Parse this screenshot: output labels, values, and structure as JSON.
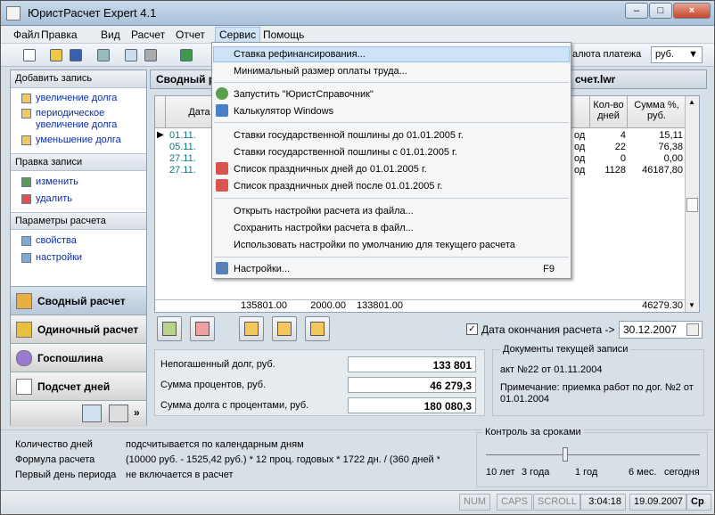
{
  "window": {
    "title": "ЮристРасчет Expert 4.1"
  },
  "menubar": {
    "items": [
      "Файл",
      "Правка",
      "Вид",
      "Расчет",
      "Отчет",
      "Сервис",
      "Помощь"
    ]
  },
  "toolbar": {
    "currency_label": "алюта платежа",
    "currency_value": "руб."
  },
  "sidebar": {
    "add_header": "Добавить запись",
    "add_items": [
      "увеличение долга",
      "периодическое увеличение долга",
      "уменьшение долга"
    ],
    "edit_header": "Правка записи",
    "edit_items": [
      "изменить",
      "удалить"
    ],
    "params_header": "Параметры расчета",
    "params_items": [
      "свойства",
      "настройки"
    ],
    "nav": [
      "Сводный расчет",
      "Одиночный расчет",
      "Госпошлина",
      "Подсчет дней"
    ]
  },
  "panel": {
    "title_left": "Сводный р",
    "title_right": "счет.lwr"
  },
  "grid": {
    "headers": {
      "date": "Дата",
      "days": "Кол-во дней",
      "sum": "Сумма %, руб."
    },
    "rows": [
      {
        "date": "01.11.",
        "code": "од",
        "days": "4",
        "sum": "15,11"
      },
      {
        "date": "05.11.",
        "code": "од",
        "days": "22",
        "sum": "76,38"
      },
      {
        "date": "27.11.",
        "code": "од",
        "days": "0",
        "sum": "0,00"
      },
      {
        "date": "27.11.",
        "code": "од",
        "days": "1128",
        "sum": "46187,80"
      }
    ],
    "totals": [
      "135801.00",
      "2000.00",
      "133801.00",
      "46279.30"
    ]
  },
  "end_date": {
    "label": "Дата окончания расчета ->",
    "value": "30.12.2007"
  },
  "summary": {
    "rows": [
      {
        "label": "Непогашенный долг, руб.",
        "value": "133 801"
      },
      {
        "label": "Сумма процентов, руб.",
        "value": "46 279,3"
      },
      {
        "label": "Сумма долга с процентами, руб.",
        "value": "180 080,3"
      }
    ]
  },
  "docs": {
    "title": "Документы текущей записи",
    "line1": "акт №22 от 01.11.2004",
    "line2": "Примечание: приемка работ по дог. №2 от 01.01.2004"
  },
  "bottom": {
    "rows": [
      {
        "label": "Количество дней",
        "value": "подсчитывается по календарным дням"
      },
      {
        "label": "Формула расчета",
        "value": "(10000 руб. - 1525,42 руб.) * 12 проц. годовых * 1722 дн. / (360 дней * 1"
      },
      {
        "label": "Первый день периода",
        "value": "не включается в расчет"
      }
    ]
  },
  "control": {
    "title": "Контроль за сроками",
    "ticks": [
      "10 лет",
      "3 года",
      "1 год",
      "6 мес.",
      "сегодня"
    ]
  },
  "status": {
    "num": "NUM",
    "caps": "CAPS",
    "scroll": "SCROLL",
    "time": "3:04:18",
    "date": "19.09.2007",
    "extra": "Ср"
  },
  "menu": {
    "items": [
      {
        "label": "Ставка рефинансирования...",
        "shortcut": ""
      },
      {
        "label": "Минимальный размер оплаты труда...",
        "shortcut": ""
      },
      {
        "label": "Запустить \"ЮристСправочник\"",
        "shortcut": ""
      },
      {
        "label": "Калькулятор Windows",
        "shortcut": ""
      },
      {
        "label": "Ставки государственной пошлины до 01.01.2005 г.",
        "shortcut": ""
      },
      {
        "label": "Ставки государственной пошлины с 01.01.2005 г.",
        "shortcut": ""
      },
      {
        "label": "Список праздничных дней до 01.01.2005 г.",
        "shortcut": ""
      },
      {
        "label": "Список праздничных дней после 01.01.2005 г.",
        "shortcut": ""
      },
      {
        "label": "Открыть настройки расчета из файла...",
        "shortcut": ""
      },
      {
        "label": "Сохранить настройки расчета в файл...",
        "shortcut": ""
      },
      {
        "label": "Использовать настройки по умолчанию для текущего расчета",
        "shortcut": ""
      },
      {
        "label": "Настройки...",
        "shortcut": "F9"
      }
    ]
  }
}
